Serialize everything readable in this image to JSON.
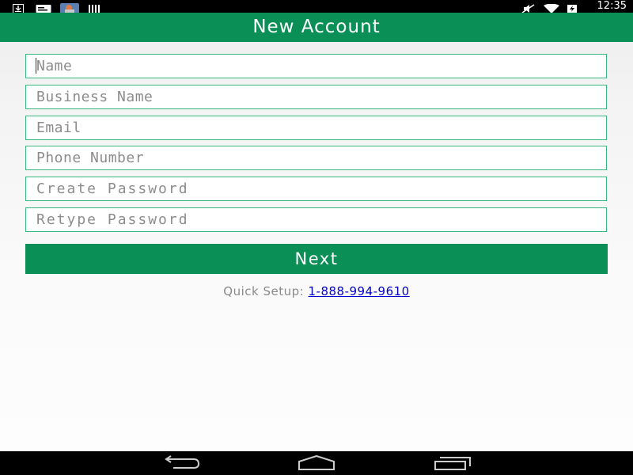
{
  "status_bar": {
    "time": "12:35",
    "left_icons": [
      "download-icon",
      "notification-card-icon",
      "image-thumbnail-icon",
      "barcode-icon"
    ],
    "right_icons": [
      "mute-icon",
      "wifi-icon",
      "battery-charging-icon"
    ]
  },
  "header": {
    "title": "New Account"
  },
  "form": {
    "name_placeholder": "Name",
    "business_name_placeholder": "Business Name",
    "email_placeholder": "Email",
    "phone_placeholder": "Phone Number",
    "create_password_placeholder": "Create Password",
    "retype_password_placeholder": "Retype Password",
    "next_label": "Next"
  },
  "quick_setup": {
    "label": "Quick Setup:",
    "phone": "1-888-994-9610"
  },
  "nav_bar": {
    "buttons": [
      "back-icon",
      "home-icon",
      "recents-icon"
    ]
  },
  "colors": {
    "accent_green": "#0a9057",
    "field_border": "#35b77e",
    "link_blue": "#0000cc",
    "status_bar": "#000000"
  }
}
